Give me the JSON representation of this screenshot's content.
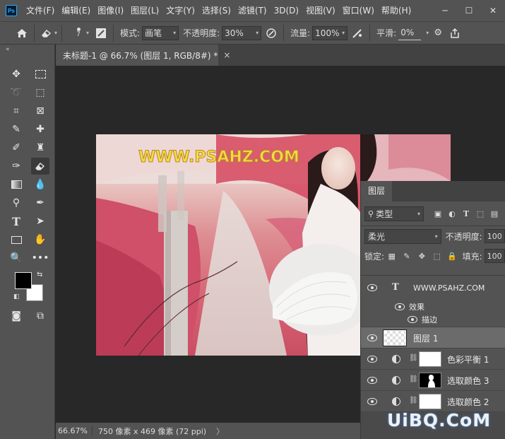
{
  "menubar": {
    "logo": "Ps",
    "items": [
      "文件(F)",
      "编辑(E)",
      "图像(I)",
      "图层(L)",
      "文字(Y)",
      "选择(S)",
      "滤镜(T)",
      "3D(D)",
      "视图(V)",
      "窗口(W)",
      "帮助(H)"
    ]
  },
  "options": {
    "brush_size": "7",
    "mode_label": "模式:",
    "mode_value": "画笔",
    "opacity_label": "不透明度:",
    "opacity_value": "30%",
    "flow_label": "流量:",
    "flow_value": "100%",
    "smooth_label": "平滑:",
    "smooth_value": "0%"
  },
  "document": {
    "tab_title": "未标题-1 @ 66.7% (图层 1, RGB/8#) *",
    "close": "×",
    "photo_caption": "WWW.PSAHZ.COM"
  },
  "status": {
    "zoom": "66.67%",
    "info": "750 像素 x 469 像素 (72 ppi)"
  },
  "layers_panel": {
    "tab": "图层",
    "filter_label": "类型",
    "blend_mode": "柔光",
    "opacity_label": "不透明度:",
    "opacity_value": "100",
    "lock_label": "锁定:",
    "fill_label": "填充:",
    "fill_value": "100",
    "text_layer": "WWW.PSAHZ.COM",
    "effects_label": "效果",
    "stroke_label": "描边",
    "layer1": "图层 1",
    "adj1": "色彩平衡 1",
    "adj2": "选取颜色 3",
    "adj3": "选取颜色 2"
  },
  "watermark": "UiBQ.CoM",
  "colors": {
    "foreground": "#000000",
    "background": "#ffffff",
    "caption": "#f5d94a"
  }
}
